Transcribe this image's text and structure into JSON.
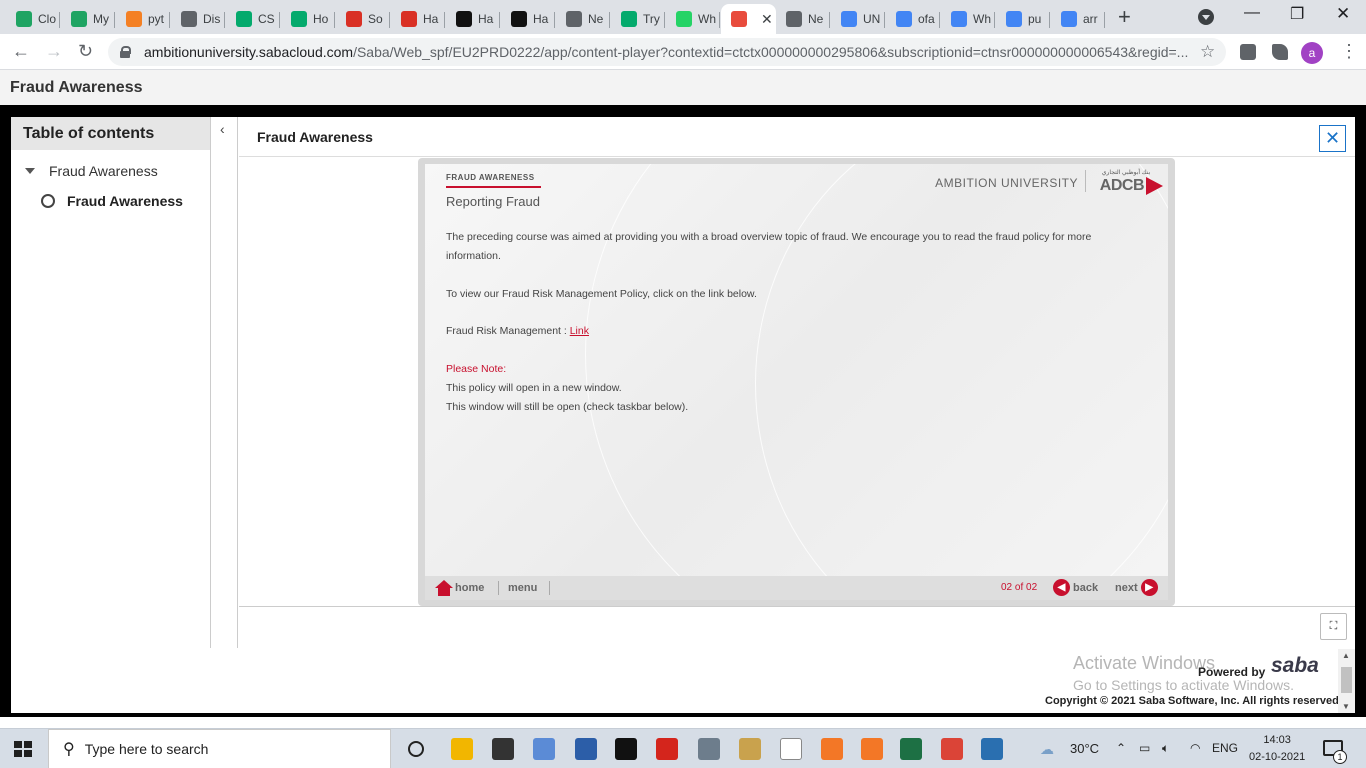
{
  "browser": {
    "tabs": [
      {
        "label": "Clo",
        "icon": "google-drive-icon",
        "color": "#1fa463"
      },
      {
        "label": "My",
        "icon": "google-drive-icon",
        "color": "#1fa463"
      },
      {
        "label": "pyt",
        "icon": "stackoverflow-icon",
        "color": "#f48024"
      },
      {
        "label": "Dis",
        "icon": "globe-icon",
        "color": "#5f6368"
      },
      {
        "label": "CS",
        "icon": "w3-icon",
        "color": "#04aa6d"
      },
      {
        "label": "Ho",
        "icon": "w3-icon",
        "color": "#04aa6d"
      },
      {
        "label": "So",
        "icon": "gmail-icon",
        "color": "#d93025"
      },
      {
        "label": "Ha",
        "icon": "gmail-icon",
        "color": "#d93025"
      },
      {
        "label": "Ha",
        "icon": "hackerrank-icon",
        "color": "#111111"
      },
      {
        "label": "Ha",
        "icon": "hackerrank-icon",
        "color": "#111111"
      },
      {
        "label": "Ne",
        "icon": "globe-icon",
        "color": "#5f6368"
      },
      {
        "label": "Try",
        "icon": "w3-icon",
        "color": "#04aa6d"
      },
      {
        "label": "Wh",
        "icon": "whatsapp-icon",
        "color": "#25d366"
      },
      {
        "label": "",
        "icon": "saba-icon",
        "color": "#e84c3d",
        "active": true,
        "close": "✕"
      },
      {
        "label": "Ne",
        "icon": "globe-icon",
        "color": "#5f6368"
      },
      {
        "label": "UN",
        "icon": "google-icon",
        "color": "#4285f4"
      },
      {
        "label": "ofa",
        "icon": "google-icon",
        "color": "#4285f4"
      },
      {
        "label": "Wh",
        "icon": "google-icon",
        "color": "#4285f4"
      },
      {
        "label": "pu",
        "icon": "google-icon",
        "color": "#4285f4"
      },
      {
        "label": "arr",
        "icon": "google-icon",
        "color": "#4285f4"
      }
    ],
    "new_tab": "+",
    "window_controls": {
      "minimize": "—",
      "restore": "❐",
      "close": "✕"
    },
    "nav": {
      "back": "←",
      "forward": "→",
      "reload": "↻"
    },
    "url_domain": "ambitionuniversity.sabacloud.com",
    "url_path": "/Saba/Web_spf/EU2PRD0222/app/content-player?contextid=ctctx000000000295806&subscriptionid=ctnsr000000000006543&regid=...",
    "bookmark_star": "☆",
    "profile_initial": "a",
    "menu": "⋮"
  },
  "page": {
    "title": "Fraud Awareness"
  },
  "toc": {
    "heading": "Table of contents",
    "collapse_glyph": "‹",
    "section": "Fraud Awareness",
    "item": "Fraud Awareness"
  },
  "content": {
    "title": "Fraud Awareness",
    "close_glyph": "✕",
    "fullscreen_glyph": "⛶"
  },
  "slide": {
    "kicker": "FRAUD AWARENESS",
    "title": "Reporting Fraud",
    "brand": "AMBITION UNIVERSITY",
    "logo_text": "ADCB",
    "logo_arabic": "بنك أبوظبي التجاري",
    "paragraph1": "The preceding course was aimed at providing you with a broad overview topic of fraud. We encourage you to read the fraud policy for more information.",
    "paragraph2": "To view our Fraud Risk Management Policy, click on the link below.",
    "link_label": "Fraud Risk Management : ",
    "link_text": "Link",
    "note_label": "Please Note:",
    "note_line1": "This policy will open in a new window.",
    "note_line2": "This window will still be open (check taskbar below).",
    "nav": {
      "home": "home",
      "menu": "menu",
      "page": "02 of 02",
      "back": "back",
      "next": "next"
    },
    "accent_color": "#c8102e"
  },
  "footer": {
    "powered_by": "Powered by",
    "brand": "saba",
    "copyright": "Copyright © 2021 Saba Software, Inc. All rights reserved.",
    "watermark_line1": "Activate Windows",
    "watermark_line2": "Go to Settings to activate Windows."
  },
  "taskbar": {
    "search_placeholder": "Type here to search",
    "weather": "30°C",
    "language": "ENG",
    "time": "14:03",
    "date": "02-10-2021",
    "notification_count": "1",
    "apps": [
      {
        "name": "file-explorer-icon",
        "color": "#f2b600"
      },
      {
        "name": "terminal-icon",
        "color": "#333333"
      },
      {
        "name": "notepad-icon",
        "color": "#5b8bd6"
      },
      {
        "name": "visual-studio-icon",
        "color": "#2c5ea8"
      },
      {
        "name": "pycharm-icon",
        "color": "#111111"
      },
      {
        "name": "pdf-reader-icon",
        "color": "#d4251c"
      },
      {
        "name": "calculator-icon",
        "color": "#6d7d8c"
      },
      {
        "name": "paint-icon",
        "color": "#c9a24d"
      },
      {
        "name": "document-icon",
        "color": "#ffffff"
      },
      {
        "name": "jupyter-icon",
        "color": "#f37726"
      },
      {
        "name": "jupyter-icon",
        "color": "#f37726"
      },
      {
        "name": "excel-icon",
        "color": "#1d7044"
      },
      {
        "name": "chrome-icon",
        "color": "#db4437"
      },
      {
        "name": "photos-icon",
        "color": "#2a6fb0"
      }
    ]
  }
}
